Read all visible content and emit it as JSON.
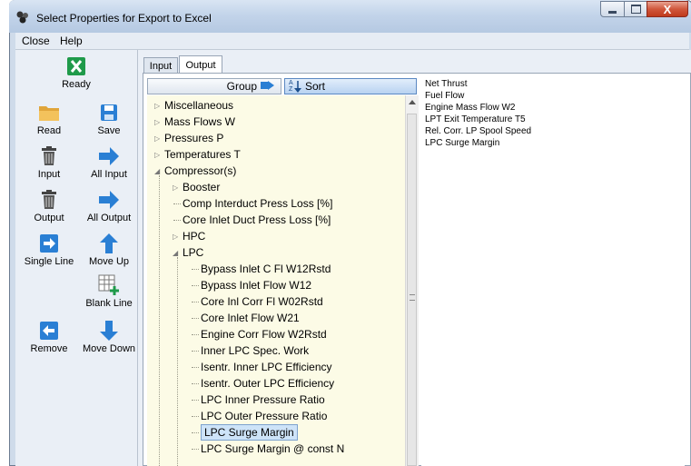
{
  "window": {
    "title": "Select Properties for Export to Excel"
  },
  "caption_buttons": {
    "close": "X"
  },
  "menu": {
    "items": [
      "Close",
      "Help"
    ]
  },
  "toolbar": {
    "ready": "Ready",
    "read": "Read",
    "save": "Save",
    "input": "Input",
    "all_input": "All Input",
    "output": "Output",
    "all_output": "All Output",
    "single_line": "Single Line",
    "move_up": "Move Up",
    "blank_line": "Blank Line",
    "remove": "Remove",
    "move_down": "Move Down"
  },
  "tabs": {
    "input": "Input",
    "output": "Output",
    "active": "Output"
  },
  "header": {
    "group": "Group",
    "sort": "Sort",
    "sort_icon": "AZ"
  },
  "tree": {
    "top": [
      {
        "label": "Miscellaneous",
        "expanded": false
      },
      {
        "label": "Mass Flows W",
        "expanded": false
      },
      {
        "label": "Pressures P",
        "expanded": false
      },
      {
        "label": "Temperatures T",
        "expanded": false
      },
      {
        "label": "Compressor(s)",
        "expanded": true
      }
    ],
    "compressor_children": [
      "Booster",
      "Comp Interduct Press Loss [%]",
      "Core Inlet Duct Press Loss [%]",
      "HPC",
      "LPC"
    ],
    "lpc_children": [
      "Bypass Inlet C Fl W12Rstd",
      "Bypass Inlet Flow W12",
      "Core Inl Corr Fl W02Rstd",
      "Core Inlet Flow W21",
      "Engine Corr Flow W2Rstd",
      "Inner LPC Spec. Work",
      "Isentr. Inner LPC Efficiency",
      "Isentr. Outer LPC Efficiency",
      "LPC Inner Pressure Ratio",
      "LPC Outer Pressure Ratio",
      "LPC Surge Margin",
      "LPC Surge Margin @ const N"
    ],
    "selected": "LPC Surge Margin"
  },
  "output_list": [
    "Net Thrust",
    "Fuel Flow",
    "Engine Mass Flow W2",
    "LPT Exit Temperature T5",
    "Rel. Corr. LP Spool Speed",
    "LPC Surge Margin"
  ],
  "colors": {
    "tree_bg": "#fcfbe6",
    "selection": "#cde3f8",
    "blue_icon": "#2a7fd4",
    "excel_green": "#1f9a4a"
  }
}
